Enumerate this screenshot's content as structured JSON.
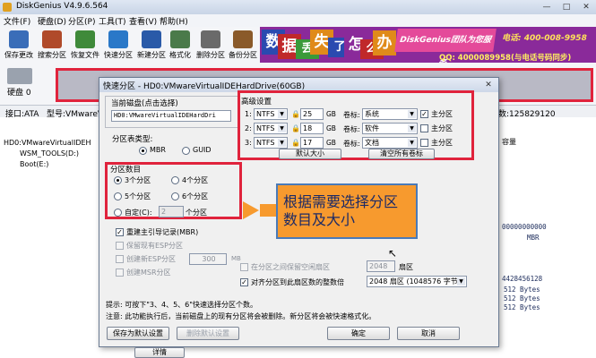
{
  "window": {
    "title": "DiskGenius V4.9.6.564",
    "controls": [
      "—",
      "□",
      "✕"
    ]
  },
  "menu": [
    "文件(F)",
    "硬盘(D)",
    "分区(P)",
    "工具(T)",
    "查看(V)",
    "帮助(H)"
  ],
  "toolbar": [
    {
      "label": "保存更改",
      "icon": "save-icon",
      "color": "#3a6db8"
    },
    {
      "label": "搜索分区",
      "icon": "search-icon",
      "color": "#b04a2a"
    },
    {
      "label": "恢复文件",
      "icon": "recover-icon",
      "color": "#3f8a3a"
    },
    {
      "label": "快速分区",
      "icon": "quick-partition-icon",
      "color": "#2a78c8"
    },
    {
      "label": "新建分区",
      "icon": "new-partition-icon",
      "color": "#2a5aa8"
    },
    {
      "label": "格式化",
      "icon": "format-icon",
      "color": "#4a7a4a"
    },
    {
      "label": "删除分区",
      "icon": "delete-icon",
      "color": "#6a6a6a"
    },
    {
      "label": "备份分区",
      "icon": "backup-icon",
      "color": "#8a5a2a"
    }
  ],
  "banner": {
    "tiles": [
      "数",
      "据",
      "丢",
      "失",
      "了",
      "怎",
      "么",
      "办"
    ],
    "tile_colors": [
      "#2a4ab0",
      "#c0282a",
      "#3a9a3a",
      "#e08a1a",
      "#2a4ab0",
      "#8a2a9a",
      "#c0282a",
      "#e08a1a"
    ],
    "brand": "DiskGenius团队为您服务",
    "phone": "电话: 400-008-9958",
    "qq": "QQ: 4000089958(与电话号码同步)"
  },
  "disk_panel": {
    "label1": "硬盘 0"
  },
  "info_strip": {
    "interface": "接口:ATA",
    "model": "型号:VMwareVirtualIDEHardDrive",
    "sectors": "数:125829120"
  },
  "tree": [
    {
      "label": "HD0:VMwareVirtualIDEH"
    },
    {
      "label": "WSM_TOOLS(D:)"
    },
    {
      "label": "Boot(E:)"
    }
  ],
  "right_pane": {
    "col_header": "容量",
    "hex": [
      "00000000000",
      "MBR",
      "4428456128",
      "512 Bytes",
      "512 Bytes",
      "512 Bytes"
    ]
  },
  "dialog": {
    "title": "快速分区 - HD0:VMwareVirtualIDEHardDrive(60GB)",
    "current_disk_label": "当前磁盘(点击选择)",
    "current_disk_value": "HD0:VMwareVirtualIDEHardDri",
    "table_type_label": "分区表类型:",
    "table_types": [
      "MBR",
      "GUID"
    ],
    "count_label": "分区数目",
    "counts": [
      "3个分区",
      "4个分区",
      "5个分区",
      "6个分区"
    ],
    "custom_label": "自定(C):",
    "custom_value": "2",
    "custom_unit": "个分区",
    "options": [
      "重建主引导记录(MBR)",
      "保留现有ESP分区",
      "创建新ESP分区",
      "创建MSR分区"
    ],
    "esp_size": "300",
    "esp_unit": "MB",
    "advanced_label": "高级设置",
    "partitions": [
      {
        "num": "1:",
        "fs": "NTFS",
        "size": "25",
        "unit": "GB",
        "vol_label": "卷标:",
        "name": "系统",
        "primary": "主分区",
        "primary_checked": true
      },
      {
        "num": "2:",
        "fs": "NTFS",
        "size": "18",
        "unit": "GB",
        "vol_label": "卷标:",
        "name": "软件",
        "primary": "主分区",
        "primary_checked": false
      },
      {
        "num": "3:",
        "fs": "NTFS",
        "size": "17",
        "unit": "GB",
        "vol_label": "卷标:",
        "name": "文档",
        "primary": "主分区",
        "primary_checked": false
      }
    ],
    "default_size_btn": "默认大小",
    "clear_labels_btn": "清空所有卷标",
    "gap_label": "在分区之间保留空闲扇区",
    "gap_value": "2048",
    "gap_unit": "扇区",
    "align_label": "对齐分区到此扇区数的整数倍",
    "align_value": "2048 扇区 (1048576 字节)",
    "hint": "提示: 可按下\"3、4、5、6\"快速选择分区个数。",
    "note": "注意: 此功能执行后，当前磁盘上的现有分区将会被删除。新分区将会被快速格式化。",
    "save_btn": "保存为默认设置",
    "delete_btn": "删除默认设置",
    "ok_btn": "确定",
    "cancel_btn": "取消",
    "detail_btn": "详情"
  },
  "callout": {
    "line1": "根据需要选择分区",
    "line2": "数目及大小"
  }
}
